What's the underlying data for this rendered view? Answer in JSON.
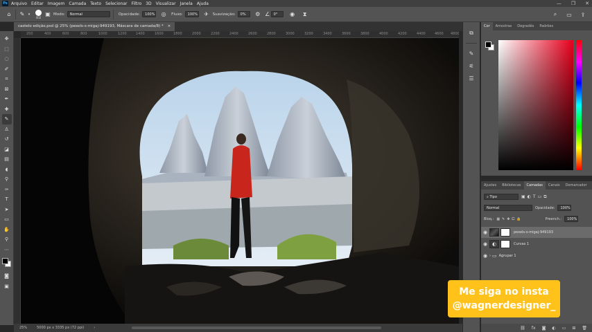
{
  "app": {
    "logo": "Ps"
  },
  "menu": [
    "Arquivo",
    "Editar",
    "Imagem",
    "Camada",
    "Texto",
    "Selecionar",
    "Filtro",
    "3D",
    "Visualizar",
    "Janela",
    "Ajuda"
  ],
  "window_controls": [
    "—",
    "❐",
    "✕"
  ],
  "options": {
    "brush_size": "402",
    "mode_label": "Modo:",
    "mode_value": "Normal",
    "opacity_label": "Opacidade:",
    "opacity_value": "100%",
    "flow_label": "Fluxo:",
    "flow_value": "100%",
    "smoothing_label": "Suavização:",
    "smoothing_value": "0%",
    "angle_value": "0°"
  },
  "document_tab": {
    "title": "castelo edição.psd @ 25% (pexels-s-migaj-949193, Máscara de camada/8) *",
    "close": "×"
  },
  "ruler": [
    "200",
    "400",
    "600",
    "800",
    "1000",
    "1200",
    "1400",
    "1600",
    "1800",
    "2000",
    "2200",
    "2400",
    "2600",
    "2800",
    "3000",
    "3200",
    "3400",
    "3600",
    "3800",
    "4000",
    "4200",
    "4400",
    "4600",
    "4800"
  ],
  "status": {
    "zoom": "25%",
    "dimensions": "5000 px x 3335 px (72 ppi)",
    "arrow": "›"
  },
  "color_panel": {
    "tabs": [
      "Cor",
      "Amostras",
      "Degradês",
      "Padrões"
    ]
  },
  "layers_panel": {
    "tabs": [
      "Ajustes",
      "Bibliotecas",
      "Camadas",
      "Canais",
      "Demarcador"
    ],
    "filter_label": "Tipo",
    "blend_mode": "Normal",
    "opacity_label": "Opacidade:",
    "opacity_value": "100%",
    "lock_label": "Bloq.:",
    "fill_label": "Preench.:",
    "fill_value": "100%",
    "layers": [
      {
        "name": "pexels-s-migaj-949193"
      },
      {
        "name": "Curvas 1"
      },
      {
        "name": "Agrupar 1"
      }
    ]
  },
  "overlay": {
    "line1": "Me siga no insta",
    "line2": "@wagnerdesigner_"
  },
  "colors": {
    "brand": "#31a8ff",
    "badge": "#ffc21a"
  }
}
